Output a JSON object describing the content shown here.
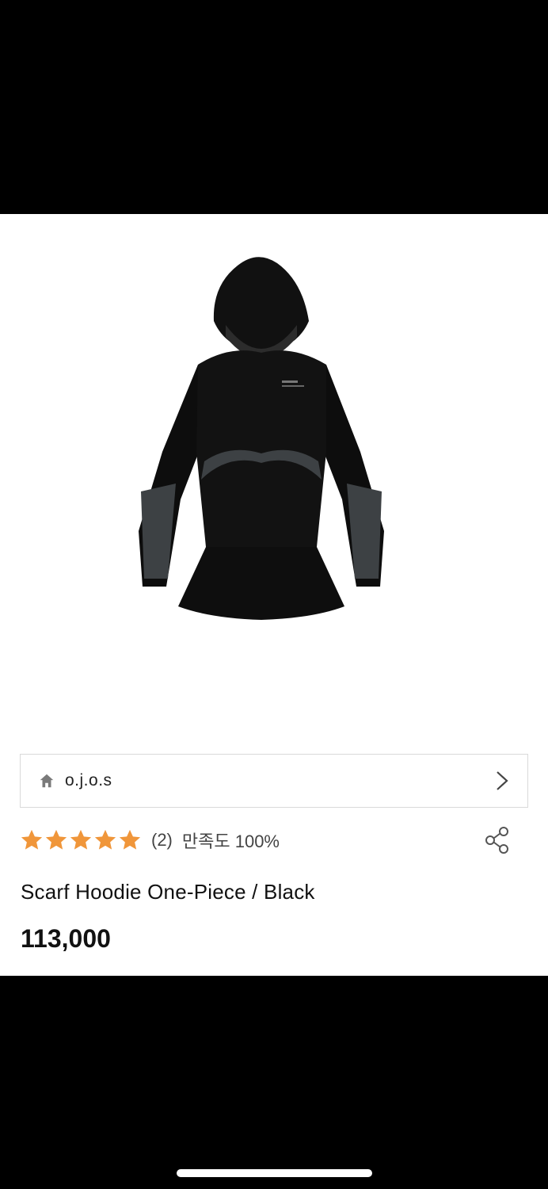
{
  "store": {
    "name": "o.j.o.s",
    "home_icon": "home-icon",
    "chevron_icon": "chevron-right-icon"
  },
  "rating": {
    "stars": 5,
    "review_count": "(2)",
    "satisfaction": "만족도 100%",
    "star_color": "#f0963a"
  },
  "product": {
    "title": "Scarf Hoodie One-Piece / Black",
    "price": "113,000"
  },
  "icons": {
    "share": "share-icon"
  }
}
